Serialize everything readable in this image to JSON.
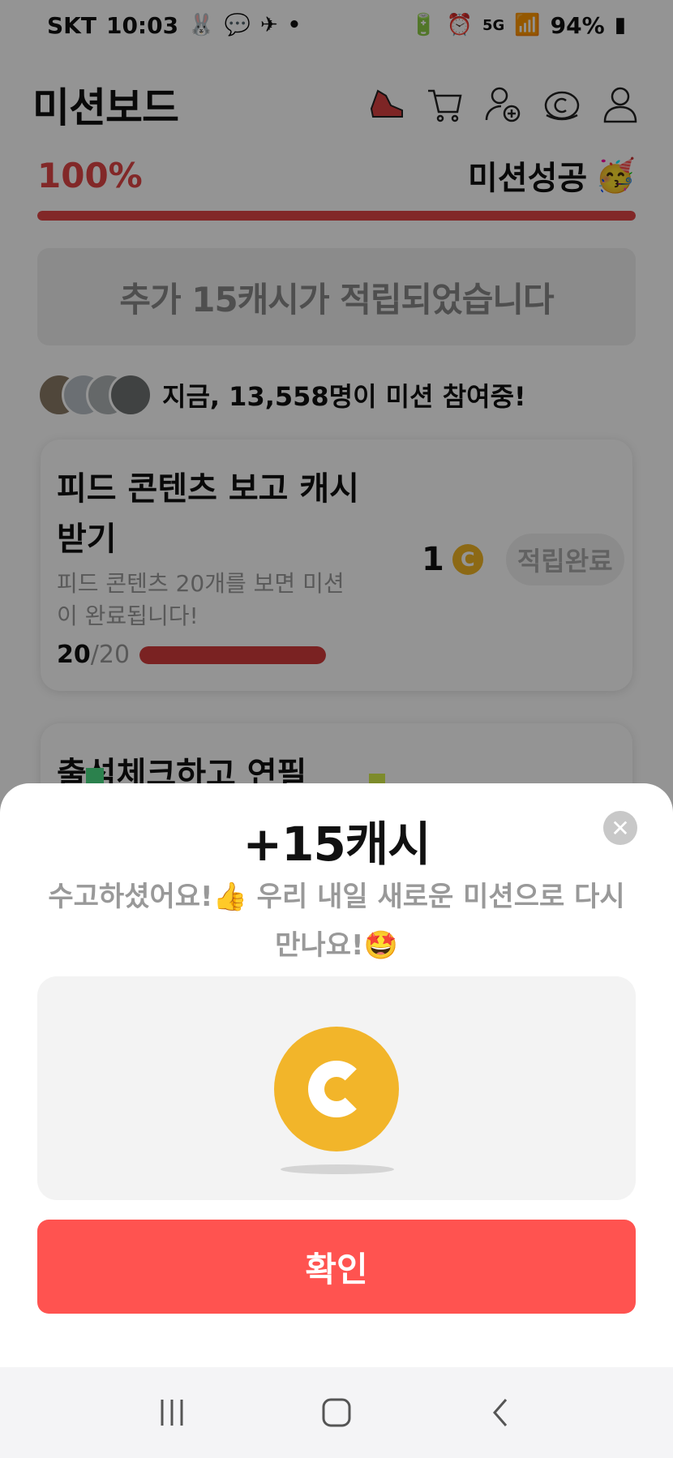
{
  "status_bar": {
    "carrier": "SKT",
    "time": "10:03",
    "network": "5G",
    "battery": "94%"
  },
  "header": {
    "title": "미션보드",
    "icons": [
      "sneaker-icon",
      "cart-icon",
      "add-friend-icon",
      "cash-coin-icon",
      "profile-icon"
    ]
  },
  "progress": {
    "percent_label": "100%",
    "percent_value": 1.0,
    "status_label": "미션성공",
    "status_emoji": "🥳"
  },
  "notice": {
    "text": "추가 15캐시가 적립되었습니다"
  },
  "participants": {
    "text": "지금, 13,558명이 미션 참여중!"
  },
  "missions": [
    {
      "title": "피드 콘텐츠 보고 캐시 받기",
      "description": "피드 콘텐츠 20개를 보면 미션이 완료됩니다!",
      "done": "20",
      "total": "/20",
      "progress_value": 1.0,
      "reward": "1",
      "status": "적립완료"
    },
    {
      "title": "출석체크하고 연필"
    }
  ],
  "sheet": {
    "title": "+15캐시",
    "message": "수고하셨어요!👍 우리 내일 새로운 미션으로 다시 만나요!🤩",
    "confirm_label": "확인",
    "close_label": "✕"
  },
  "colors": {
    "accent_red": "#e14545",
    "button_red": "#ff5350",
    "coin_gold": "#f2b52a"
  }
}
